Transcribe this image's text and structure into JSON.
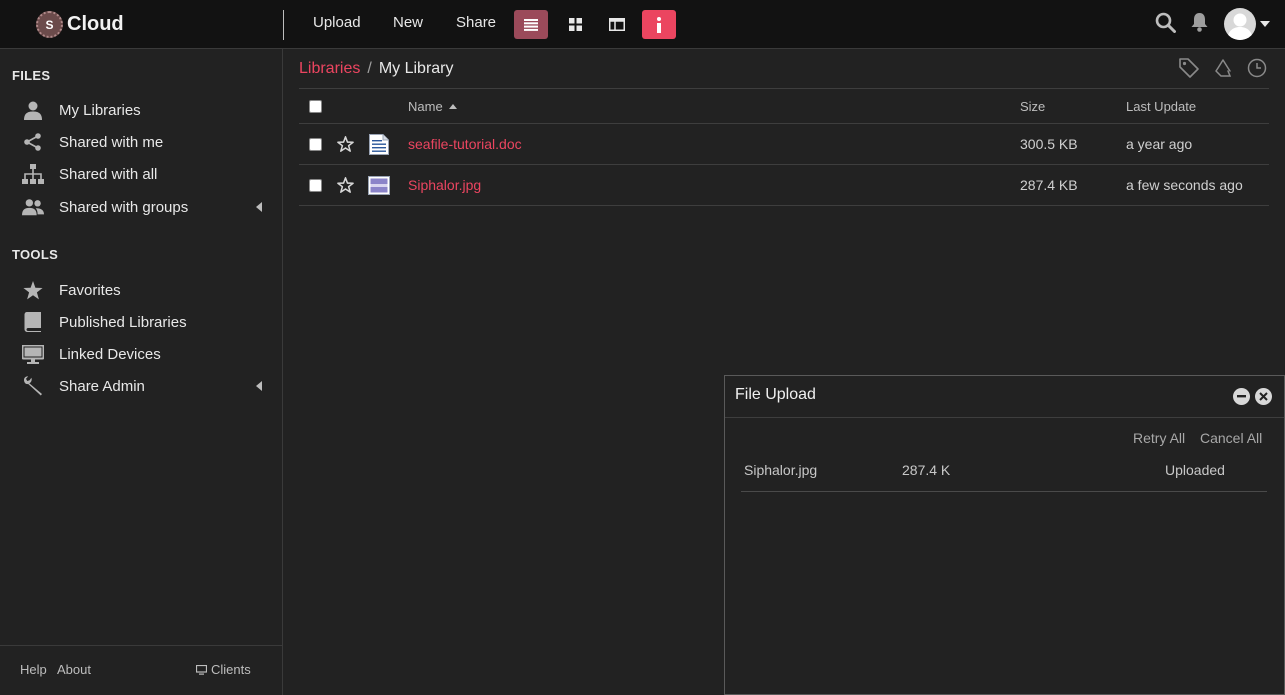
{
  "app": {
    "logo_letter": "S",
    "name": "Cloud"
  },
  "toolbar": {
    "upload_label": "Upload",
    "new_label": "New",
    "share_label": "Share"
  },
  "sidebar": {
    "files_heading": "FILES",
    "files_items": [
      {
        "label": "My Libraries",
        "icon": "user-icon"
      },
      {
        "label": "Shared with me",
        "icon": "share-nodes-icon"
      },
      {
        "label": "Shared with all",
        "icon": "org-chart-icon"
      },
      {
        "label": "Shared with groups",
        "icon": "group-icon"
      }
    ],
    "tools_heading": "TOOLS",
    "tools_items": [
      {
        "label": "Favorites",
        "icon": "star-icon"
      },
      {
        "label": "Published Libraries",
        "icon": "book-icon"
      },
      {
        "label": "Linked Devices",
        "icon": "monitor-icon"
      },
      {
        "label": "Share Admin",
        "icon": "wrench-icon"
      }
    ],
    "footer": {
      "help": "Help",
      "about": "About",
      "clients": "Clients"
    }
  },
  "breadcrumb": {
    "root": "Libraries",
    "separator": "/",
    "current": "My Library"
  },
  "table": {
    "headers": {
      "name": "Name",
      "size": "Size",
      "updated": "Last Update"
    },
    "rows": [
      {
        "name": "seafile-tutorial.doc",
        "size": "300.5 KB",
        "updated": "a year ago",
        "icon": "document-icon"
      },
      {
        "name": "Siphalor.jpg",
        "size": "287.4 KB",
        "updated": "a few seconds ago",
        "icon": "image-icon"
      }
    ]
  },
  "upload_dialog": {
    "title": "File Upload",
    "retry_all": "Retry All",
    "cancel_all": "Cancel All",
    "items": [
      {
        "name": "Siphalor.jpg",
        "size": "287.4 K",
        "status": "Uploaded"
      }
    ]
  },
  "colors": {
    "accent": "#eb4560",
    "active_view": "#9b4a5a",
    "background": "#222222",
    "topbar": "#121212"
  }
}
